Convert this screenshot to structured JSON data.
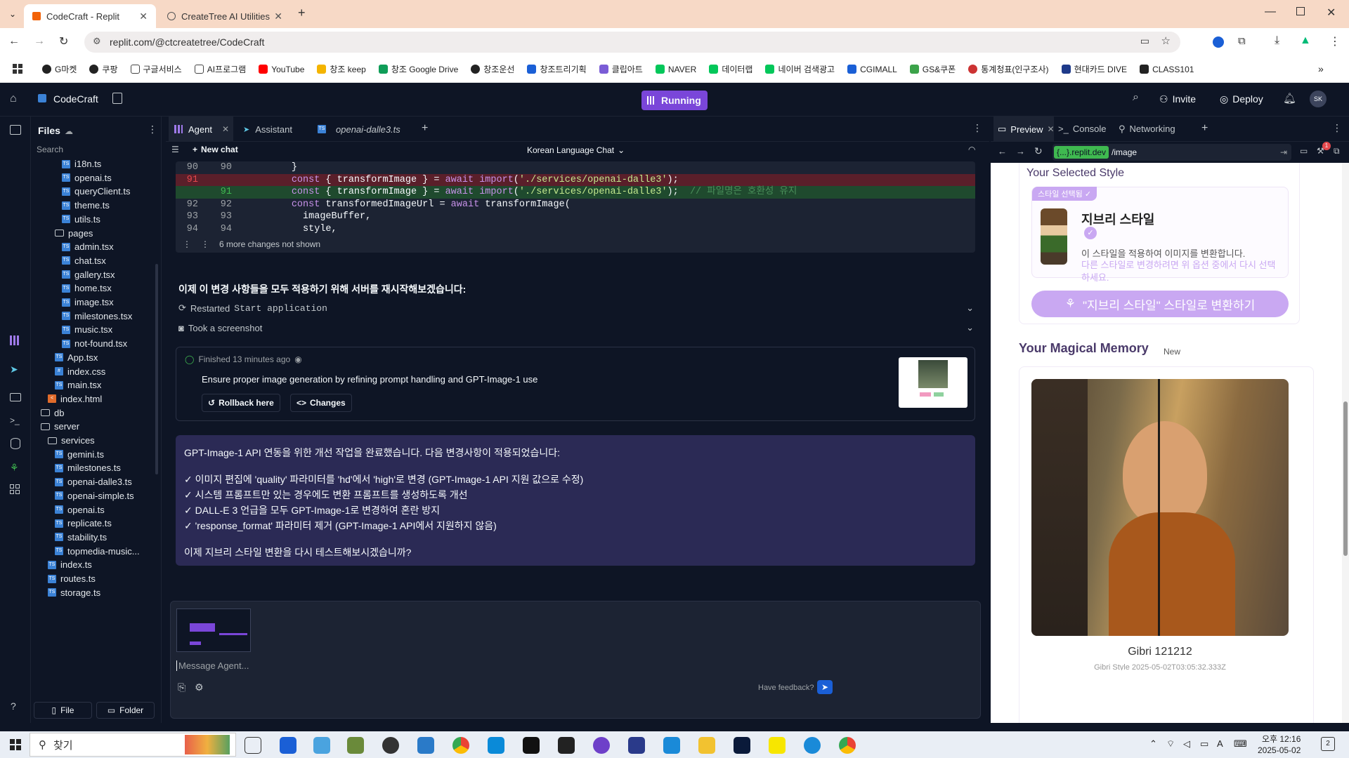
{
  "browser": {
    "tabs": [
      {
        "title": "CodeCraft - Replit",
        "active": true
      },
      {
        "title": "CreateTree AI Utilities",
        "active": false
      }
    ],
    "url": "replit.com/@ctcreatetree/CodeCraft",
    "bookmarks": [
      "G마켓",
      "쿠팡",
      "구글서비스",
      "AI프로그램",
      "YouTube",
      "창조 keep",
      "창조 Google Drive",
      "창조운선",
      "창조트리기획",
      "클립아트",
      "NAVER",
      "데이터랩",
      "네이버 검색광고",
      "CGIMALL",
      "GS&쿠폰",
      "통계청표(인구조사)",
      "현대카드 DIVE",
      "CLASS101"
    ]
  },
  "replit": {
    "project_name": "CodeCraft",
    "status": "Running",
    "invite_label": "Invite",
    "deploy_label": "Deploy",
    "avatar": "SK"
  },
  "files": {
    "title": "Files",
    "search_placeholder": "Search",
    "items": [
      {
        "name": "i18n.ts",
        "type": "ts",
        "indent": 2
      },
      {
        "name": "openai.ts",
        "type": "ts",
        "indent": 2
      },
      {
        "name": "queryClient.ts",
        "type": "ts",
        "indent": 2
      },
      {
        "name": "theme.ts",
        "type": "ts",
        "indent": 2
      },
      {
        "name": "utils.ts",
        "type": "ts",
        "indent": 2
      },
      {
        "name": "pages",
        "type": "folder",
        "indent": 1
      },
      {
        "name": "admin.tsx",
        "type": "tsx",
        "indent": 2
      },
      {
        "name": "chat.tsx",
        "type": "tsx",
        "indent": 2
      },
      {
        "name": "gallery.tsx",
        "type": "tsx",
        "indent": 2
      },
      {
        "name": "home.tsx",
        "type": "tsx",
        "indent": 2
      },
      {
        "name": "image.tsx",
        "type": "tsx",
        "indent": 2
      },
      {
        "name": "milestones.tsx",
        "type": "tsx",
        "indent": 2
      },
      {
        "name": "music.tsx",
        "type": "tsx",
        "indent": 2
      },
      {
        "name": "not-found.tsx",
        "type": "tsx",
        "indent": 2
      },
      {
        "name": "App.tsx",
        "type": "tsx",
        "indent": 1
      },
      {
        "name": "index.css",
        "type": "css",
        "indent": 1
      },
      {
        "name": "main.tsx",
        "type": "tsx",
        "indent": 1
      },
      {
        "name": "index.html",
        "type": "html",
        "indent": 0
      },
      {
        "name": "db",
        "type": "folder",
        "indent": -1
      },
      {
        "name": "server",
        "type": "folder",
        "indent": -1
      },
      {
        "name": "services",
        "type": "folder",
        "indent": 0
      },
      {
        "name": "gemini.ts",
        "type": "ts",
        "indent": 1
      },
      {
        "name": "milestones.ts",
        "type": "ts",
        "indent": 1
      },
      {
        "name": "openai-dalle3.ts",
        "type": "ts",
        "indent": 1
      },
      {
        "name": "openai-simple.ts",
        "type": "ts",
        "indent": 1
      },
      {
        "name": "openai.ts",
        "type": "ts",
        "indent": 1
      },
      {
        "name": "replicate.ts",
        "type": "ts",
        "indent": 1
      },
      {
        "name": "stability.ts",
        "type": "ts",
        "indent": 1
      },
      {
        "name": "topmedia-music...",
        "type": "ts",
        "indent": 1
      },
      {
        "name": "index.ts",
        "type": "ts",
        "indent": 0
      },
      {
        "name": "routes.ts",
        "type": "ts",
        "indent": 0
      },
      {
        "name": "storage.ts",
        "type": "ts",
        "indent": 0
      }
    ],
    "new_file_label": "File",
    "new_folder_label": "Folder"
  },
  "editor_tabs": [
    {
      "label": "Agent",
      "active": true
    },
    {
      "label": "Assistant",
      "active": false
    },
    {
      "label": "openai-dalle3.ts",
      "active": false
    }
  ],
  "chat": {
    "new_chat_label": "New chat",
    "chat_title": "Korean Language Chat",
    "diff_lines": [
      {
        "old": "90",
        "new": "90",
        "type": "ctx",
        "indent": "        ",
        "parts": [
          [
            "}",
            ""
          ]
        ]
      },
      {
        "old": "91",
        "new": "",
        "type": "del",
        "indent": "        ",
        "parts": [
          [
            "const",
            "kw"
          ],
          [
            " { transformImage } = ",
            ""
          ],
          [
            "await",
            "kw"
          ],
          [
            " ",
            ""
          ],
          [
            "import",
            "kw"
          ],
          [
            "(",
            ""
          ],
          [
            "'./services/openai-dalle3'",
            "str"
          ],
          [
            ");",
            ""
          ]
        ]
      },
      {
        "old": "",
        "new": "91",
        "type": "add",
        "indent": "        ",
        "parts": [
          [
            "const",
            "kw"
          ],
          [
            " { transformImage } = ",
            ""
          ],
          [
            "await",
            "kw"
          ],
          [
            " ",
            ""
          ],
          [
            "import",
            "kw"
          ],
          [
            "(",
            ""
          ],
          [
            "'./services/openai-dalle3'",
            "str"
          ],
          [
            ");  ",
            ""
          ],
          [
            "// 파일명은 호환성 유지",
            "cm"
          ]
        ]
      },
      {
        "old": "92",
        "new": "92",
        "type": "ctx",
        "indent": "        ",
        "parts": [
          [
            "const",
            "kw"
          ],
          [
            " transformedImageUrl = ",
            ""
          ],
          [
            "await",
            "kw"
          ],
          [
            " transformImage(",
            ""
          ]
        ]
      },
      {
        "old": "93",
        "new": "93",
        "type": "ctx",
        "indent": "          ",
        "parts": [
          [
            "imageBuffer,",
            ""
          ]
        ]
      },
      {
        "old": "94",
        "new": "94",
        "type": "ctx",
        "indent": "          ",
        "parts": [
          [
            "style,",
            ""
          ]
        ]
      }
    ],
    "more_changes": "6 more changes not shown",
    "agent_message_1": "이제 이 변경 사항들을 모두 적용하기 위해 서버를 재시작해보겠습니다:",
    "action_restarted": "Restarted",
    "action_restarted_target": "Start application",
    "action_screenshot": "Took a screenshot",
    "checkpoint": {
      "status": "Finished 13 minutes ago",
      "title": "Ensure proper image generation by refining prompt handling and GPT-Image-1 use",
      "rollback_label": "Rollback here",
      "changes_label": "Changes"
    },
    "summary": {
      "intro": "GPT-Image-1 API 연동을 위한 개선 작업을 완료했습니다. 다음 변경사항이 적용되었습니다:",
      "items": [
        "✓ 이미지 편집에 'quality' 파라미터를 'hd'에서 'high'로 변경 (GPT-Image-1 API 지원 값으로 수정)",
        "✓ 시스템 프롬프트만 있는 경우에도 변환 프롬프트를 생성하도록 개선",
        "✓ DALL-E 3 언급을 모두 GPT-Image-1로 변경하여 혼란 방지",
        "✓ 'response_format' 파라미터 제거 (GPT-Image-1 API에서 지원하지 않음)"
      ],
      "question": "이제 지브리 스타일 변환을 다시 테스트해보시겠습니까?"
    },
    "input_placeholder": "Message Agent...",
    "feedback_label": "Have feedback?"
  },
  "preview_panel": {
    "tabs": [
      "Preview",
      "Console",
      "Networking"
    ],
    "url_host": "{...}.replit.dev",
    "url_path": "/image",
    "selected_style_heading": "Your Selected Style",
    "style_badge": "스타일 선택됨 ✓",
    "style_name": "지브리 스타일",
    "style_desc": "이 스타일을 적용하여 이미지를 변환합니다.",
    "style_hint": "다른 스타일로 변경하려면 위 옵션 중에서 다시 선택하세요.",
    "transform_button": "\"지브리 스타일\" 스타일로 변환하기",
    "memory_heading": "Your Magical Memory",
    "memory_badge": "New",
    "memory_caption": "Gibri 121212",
    "memory_subcaption": "Gibri Style  2025-05-02T03:05:32.333Z"
  },
  "taskbar": {
    "search_placeholder": "찾기",
    "time": "오후 12:16",
    "date": "2025-05-02",
    "notification_count": "2"
  },
  "colors": {
    "replit_bg": "#0e1525",
    "panel_bg": "#1c2333",
    "running_purple": "#7a46d9",
    "summary_bg": "#2b2a55",
    "preview_purple": "#c9a8f2"
  }
}
